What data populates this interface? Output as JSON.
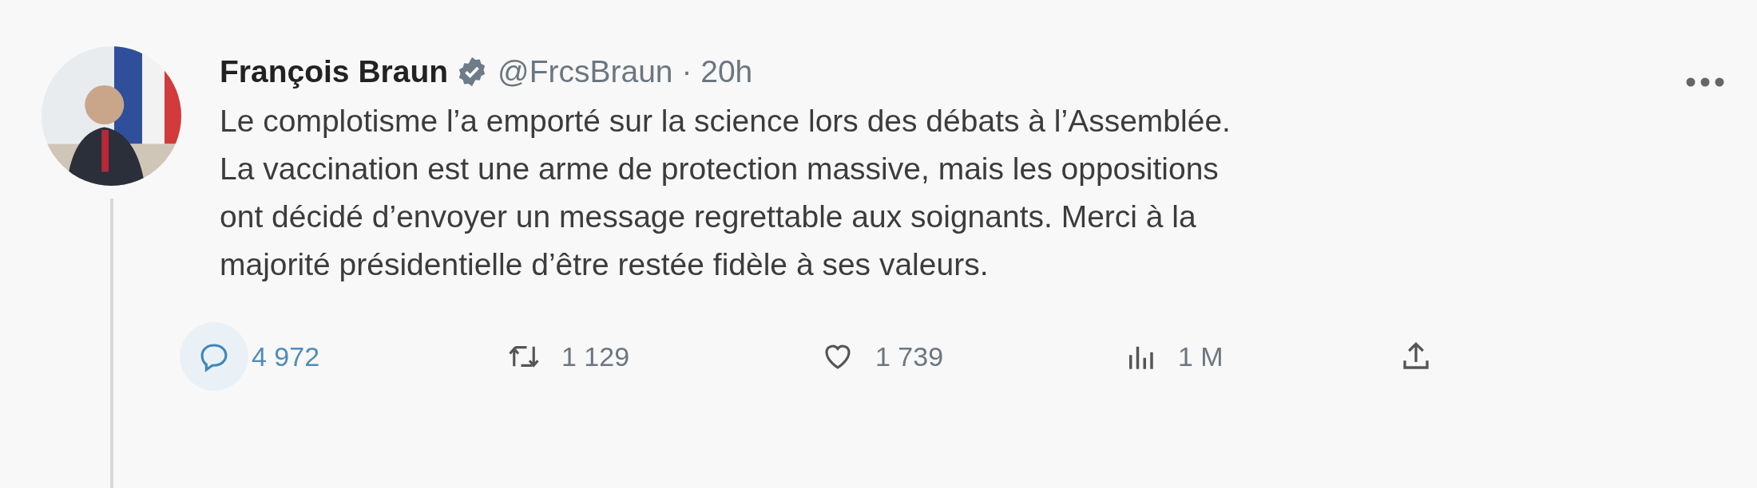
{
  "tweet": {
    "author": {
      "name": "François Braun",
      "verified": true,
      "handle": "@FrcsBraun",
      "separator": "·",
      "time": "20h"
    },
    "text_lines": [
      "Le complotisme l’a emporté sur la science lors des débats à l’Assemblée.",
      "La vaccination est une arme de protection massive, mais les oppositions",
      "ont décidé d’envoyer un message regrettable aux soignants. Merci à la",
      "majorité présidentielle d’être restée fidèle à ses valeurs."
    ],
    "actions": [
      {
        "kind": "reply",
        "count": "4 972",
        "highlighted": true
      },
      {
        "kind": "retweet",
        "count": "1 129",
        "highlighted": false
      },
      {
        "kind": "like",
        "count": "1 739",
        "highlighted": false
      },
      {
        "kind": "views",
        "count": "1 M",
        "highlighted": false
      },
      {
        "kind": "share",
        "highlighted": false
      }
    ]
  }
}
